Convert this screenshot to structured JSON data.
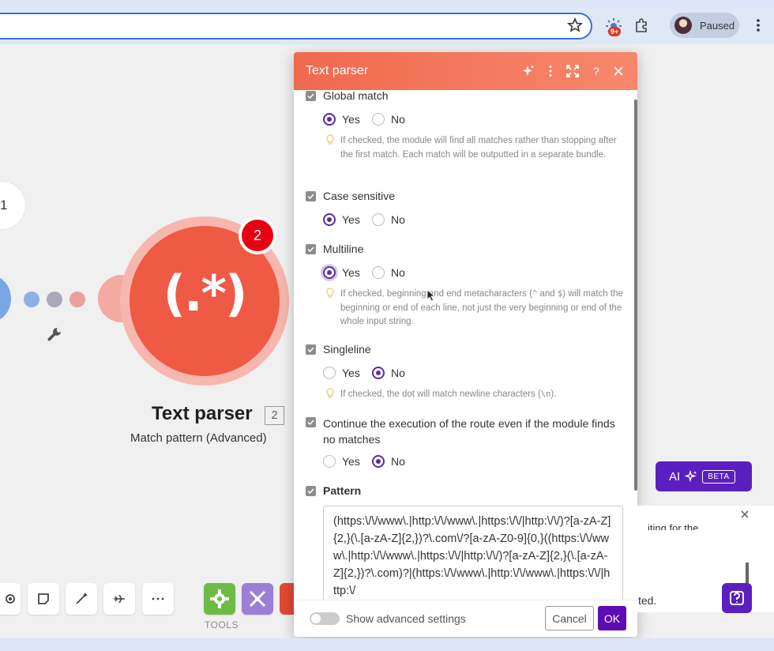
{
  "browser": {
    "profile_status": "Paused",
    "extension_badge": "9+"
  },
  "canvas": {
    "left_node_number": "1",
    "module_glyph": "(.*)",
    "module_badge_count": "2",
    "module_title": "Text parser",
    "module_id": "2",
    "module_subtitle": "Match pattern (Advanced)",
    "toolbar_section_label": "TOOLS"
  },
  "dialog": {
    "title": "Text parser",
    "fields": [
      {
        "label": "Global match",
        "yes_label": "Yes",
        "no_label": "No",
        "selected": "Yes",
        "hint": "If checked, the module will find all matches rather than stopping after the first match. Each match will be outputted in a separate bundle."
      },
      {
        "label": "Case sensitive",
        "yes_label": "Yes",
        "no_label": "No",
        "selected": "Yes"
      },
      {
        "label": "Multiline",
        "yes_label": "Yes",
        "no_label": "No",
        "selected": "Yes",
        "hint_before": "If checked, beginning and end metacharacters (",
        "hint_code_1": "^",
        "hint_middle": " and ",
        "hint_code_2": "$",
        "hint_after": ") will match the beginning or end of each line, not just the very beginning or end of the whole input string."
      },
      {
        "label": "Singleline",
        "yes_label": "Yes",
        "no_label": "No",
        "selected": "No",
        "hint_before": "If checked, the dot will match newline characters (",
        "hint_code": "\\n",
        "hint_after": ")."
      },
      {
        "label": "Continue the execution of the route even if the module finds no matches",
        "yes_label": "Yes",
        "no_label": "No",
        "selected": "No"
      }
    ],
    "pattern_label": "Pattern",
    "pattern_value": "(https:\\/\\/www\\.|http:\\/\\/www\\.|https:\\/\\/|http:\\/\\/)?[a-zA-Z]{2,}(\\.[a-zA-Z]{2,})?\\.com\\/?[a-zA-Z0-9]{0,}((https:\\/\\/www\\.|http:\\/\\/www\\.|https:\\/\\/|http:\\/\\/)?[a-zA-Z]{2,}(\\.[a-zA-Z]{2,})?\\.com)?|(https:\\/\\/www\\.|http:\\/\\/www\\.|https:\\/\\/|http:\\/",
    "advanced_settings_label": "Show advanced settings",
    "cancel_label": "Cancel",
    "ok_label": "OK"
  },
  "side": {
    "ai_label": "AI",
    "beta_label": "BETA",
    "toast_line_1": "iting for the",
    "toast_line_2": "ted."
  },
  "colors": {
    "header_orange": "#f0694f",
    "module_red": "#ef5a45",
    "accent_purple": "#5e0ab5",
    "badge_red": "#e60012"
  }
}
